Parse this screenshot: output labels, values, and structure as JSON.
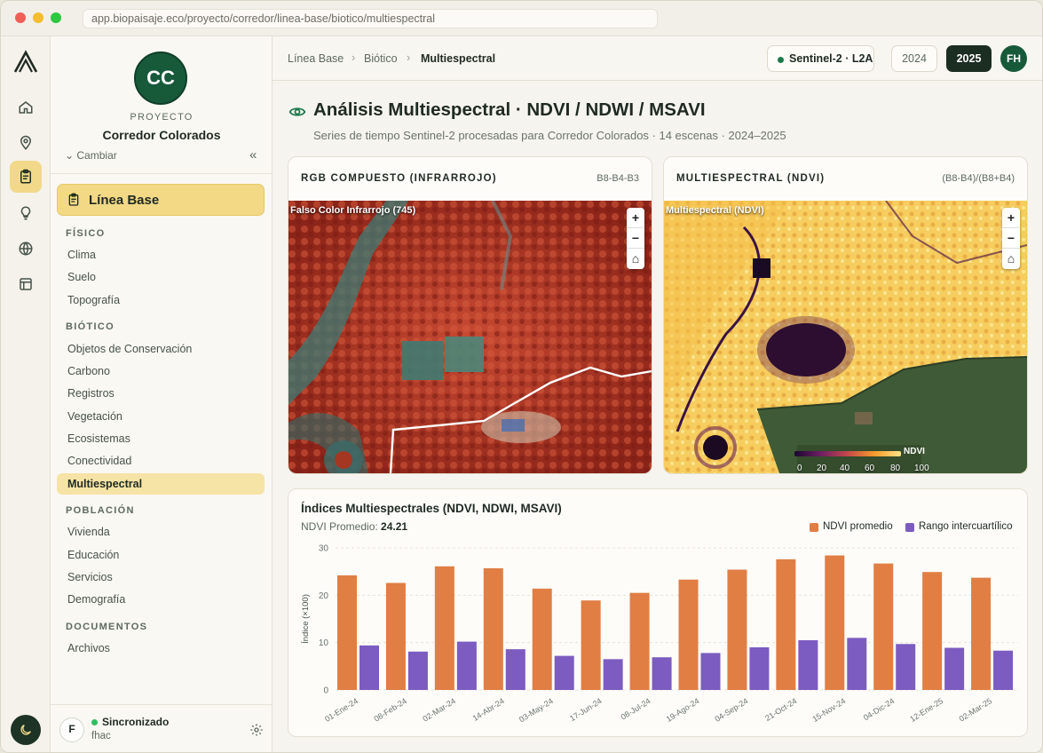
{
  "browser": {
    "url": "app.biopaisaje.eco/proyecto/corredor/linea-base/biotico/multiespectral"
  },
  "colors": {
    "accent_green": "#175a3a",
    "highlight_yellow": "#f3d986",
    "ndvi_bar": "#e07e44",
    "iqr_bar": "#7c5cc0"
  },
  "rail": {
    "icons": [
      "logo-icon",
      "home-icon",
      "map-pin-icon",
      "clipboard-icon",
      "lightbulb-icon",
      "globe-icon",
      "layout-icon",
      "moon-icon"
    ]
  },
  "project": {
    "initials": "CC",
    "kicker": "PROYECTO",
    "name": "Corredor Colorados",
    "change_label": "Cambiar",
    "collapse_glyph": "«"
  },
  "nav": {
    "main_label": "Línea Base",
    "sections": [
      {
        "title": "FÍSICO",
        "items": [
          "Clima",
          "Suelo",
          "Topografía"
        ]
      },
      {
        "title": "BIÓTICO",
        "items": [
          "Objetos de Conservación",
          "Carbono",
          "Registros",
          "Vegetación",
          "Ecosistemas",
          "Conectividad",
          "Multiespectral"
        ]
      },
      {
        "title": "POBLACIÓN",
        "items": [
          "Vivienda",
          "Educación",
          "Servicios",
          "Demografía"
        ]
      },
      {
        "title": "DOCUMENTOS",
        "items": [
          "Archivos"
        ]
      }
    ],
    "active_item": "Multiespectral"
  },
  "user": {
    "initial": "F",
    "status": "Sincronizado",
    "name": "fhac"
  },
  "breadcrumb": {
    "items": [
      "Línea Base",
      "Biótico",
      "Multiespectral"
    ],
    "separator": "›"
  },
  "topbar": {
    "sensor": "Sentinel-2 · L2A",
    "years": [
      "2024",
      "2025"
    ],
    "active_year": "2025",
    "user_initials": "FH"
  },
  "page": {
    "title": "Análisis Multiespectral · NDVI / NDWI / MSAVI",
    "subtitle": "Series de tiempo Sentinel-2 procesadas para Corredor Colorados · 14 escenas · 2024–2025"
  },
  "map_rgb": {
    "title": "RGB COMPUESTO (INFRARROJO)",
    "bands": "B8-B4-B3",
    "overlay_label": "Falso Color Infrarrojo (745)",
    "zoom": [
      "+",
      "−",
      "⌂"
    ]
  },
  "map_ndvi": {
    "title": "MULTIESPECTRAL (NDVI)",
    "formula": "(B8-B4)/(B8+B4)",
    "overlay_label": "Multiespectral (NDVI)",
    "zoom": [
      "+",
      "−",
      "⌂"
    ],
    "legend_label": "NDVI",
    "legend_ticks": [
      "0",
      "20",
      "40",
      "60",
      "80",
      "100"
    ]
  },
  "chart_panel": {
    "title": "Índices Multiespectrales (NDVI, NDWI, MSAVI)",
    "summary_label": "NDVI Promedio:",
    "summary_value": "24.21"
  },
  "chart_data": {
    "type": "bar",
    "categories": [
      "01-Ene-24",
      "08-Feb-24",
      "02-Mar-24",
      "14-Abr-24",
      "03-May-24",
      "17-Jun-24",
      "08-Jul-24",
      "19-Ago-24",
      "04-Sep-24",
      "21-Oct-24",
      "15-Nov-24",
      "04-Dic-24",
      "12-Ene-25",
      "02-Mar-25"
    ],
    "series": [
      {
        "name": "NDVI promedio",
        "color": "#e07e44",
        "values": [
          24.2,
          22.6,
          26.1,
          25.7,
          21.4,
          18.9,
          20.5,
          23.3,
          25.4,
          27.6,
          28.4,
          26.7,
          24.9,
          23.7
        ]
      },
      {
        "name": "Rango intercuartílico",
        "color": "#7c5cc0",
        "values": [
          9.4,
          8.1,
          10.2,
          8.6,
          7.2,
          6.5,
          6.9,
          7.8,
          9.0,
          10.5,
          11.0,
          9.7,
          8.9,
          8.3
        ]
      }
    ],
    "ylabel": "Índice (×100)",
    "yticks": [
      "0",
      "10",
      "20",
      "30"
    ],
    "ylim": [
      0,
      30
    ],
    "grid": true,
    "legend_position": "top-right"
  }
}
